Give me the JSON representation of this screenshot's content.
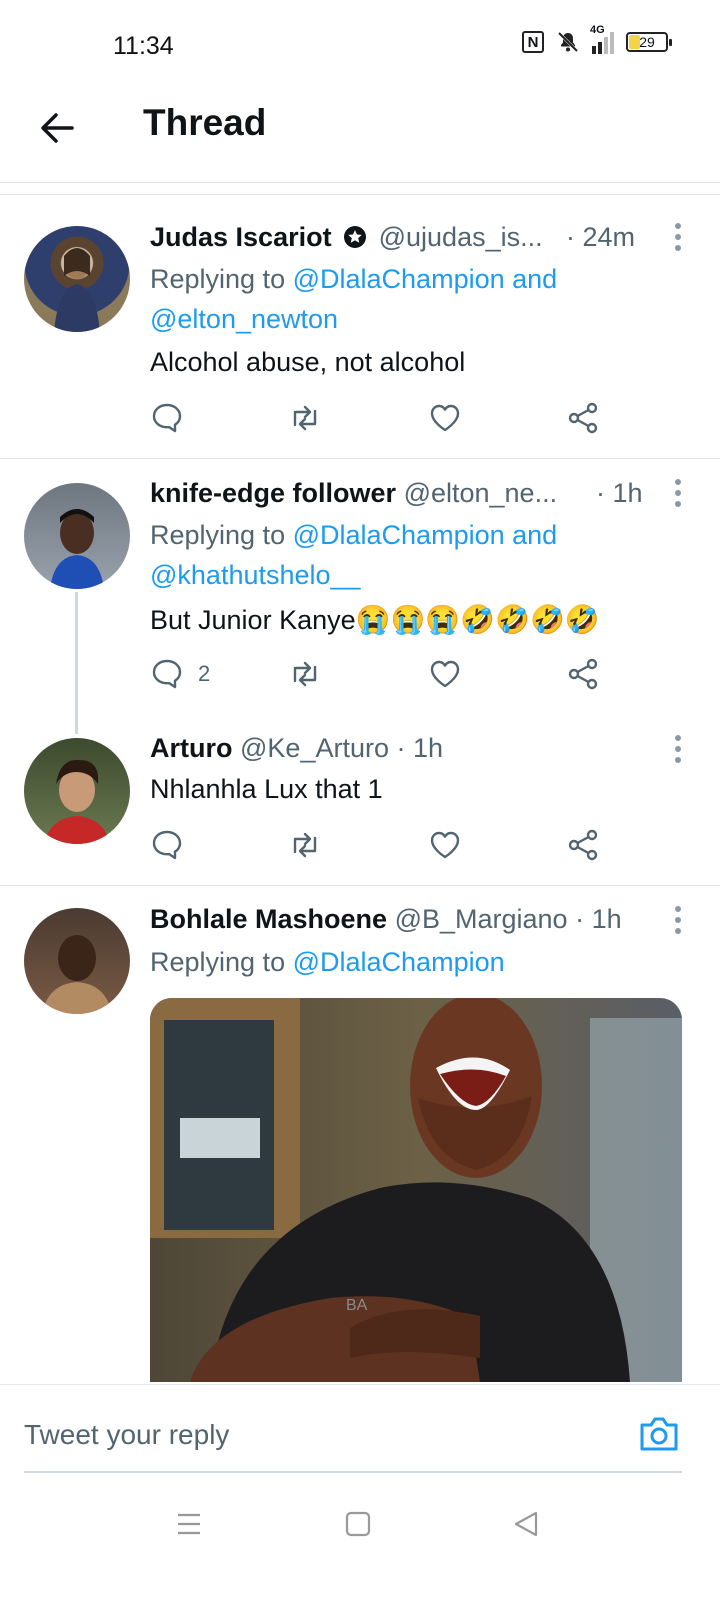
{
  "status": {
    "time": "11:34",
    "network": "4G",
    "battery": "29"
  },
  "header": {
    "title": "Thread"
  },
  "tweets": [
    {
      "name": "Judas Iscariot",
      "handle": "@ujudas_is...",
      "age": "· 24m",
      "reply_prefix": "Replying to",
      "reply_to": "@DlalaChampion and @elton_newton",
      "text": "Alcohol abuse, not alcohol"
    },
    {
      "name": "knife-edge follower",
      "handle": "@elton_ne...",
      "age": "· 1h",
      "reply_prefix": "Replying to",
      "reply_to": "@DlalaChampion and @khathutshelo__",
      "text": "But Junior Kanye",
      "emojis": "😭😭😭🤣🤣🤣🤣",
      "reply_count": "2"
    },
    {
      "name": "Arturo",
      "handle": "@Ke_Arturo",
      "age": "· 1h",
      "text": "Nhlanhla Lux that 1"
    },
    {
      "name": "Bohlale Mashoene",
      "handle": "@B_Margiano",
      "age": "· 1h",
      "reply_prefix": "Replying to",
      "reply_to": "@DlalaChampion",
      "media_text": "BA"
    }
  ],
  "compose": {
    "placeholder": "Tweet your reply"
  },
  "colors": {
    "accent": "#1d9bf0",
    "muted": "#536471"
  }
}
